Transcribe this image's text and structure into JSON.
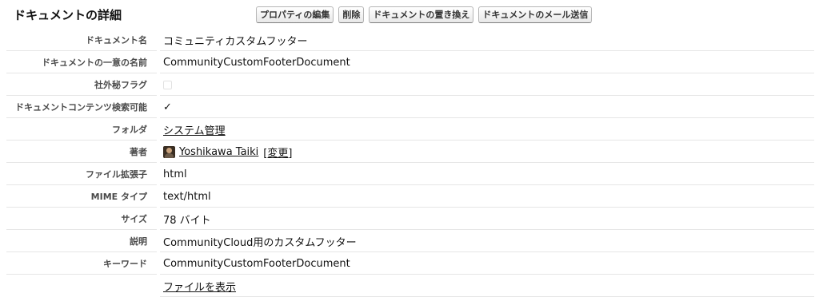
{
  "header": {
    "title": "ドキュメントの詳細",
    "buttons": {
      "edit_properties": "プロパティの編集",
      "delete": "削除",
      "replace_document": "ドキュメントの置き換え",
      "email_document": "ドキュメントのメール送信"
    }
  },
  "fields": {
    "document_name": {
      "label": "ドキュメント名",
      "value": "コミュニティカスタムフッター"
    },
    "unique_name": {
      "label": "ドキュメントの一意の名前",
      "value": "CommunityCustomFooterDocument"
    },
    "confidential": {
      "label": "社外秘フラグ",
      "checked": false
    },
    "searchable": {
      "label": "ドキュメントコンテンツ検索可能",
      "value": "✓",
      "checked": true
    },
    "folder": {
      "label": "フォルダ",
      "value": "システム管理"
    },
    "author": {
      "label": "著者",
      "value": "Yoshikawa Taiki",
      "change_link": "[変更]"
    },
    "file_extension": {
      "label": "ファイル拡張子",
      "value": "html"
    },
    "mime_type": {
      "label": "MIME タイプ",
      "value": "text/html"
    },
    "size": {
      "label": "サイズ",
      "value": "78 バイト"
    },
    "description": {
      "label": "説明",
      "value": "CommunityCloud用のカスタムフッター"
    },
    "keywords": {
      "label": "キーワード",
      "value": "CommunityCustomFooterDocument"
    },
    "view_file": {
      "label": "",
      "value": "ファイルを表示"
    }
  }
}
